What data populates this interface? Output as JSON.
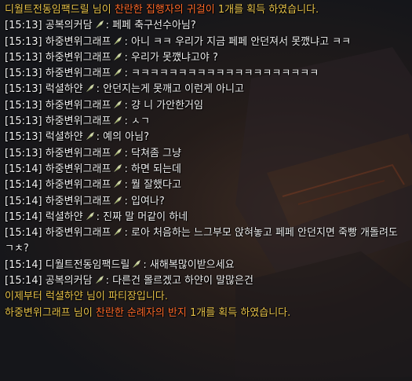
{
  "colors": {
    "system_text": "#e8c34a",
    "item_text": "#ff6a2a",
    "chat_text": "#f2f2f2"
  },
  "icons": {
    "badge": "wing-badge-icon"
  },
  "messages": [
    {
      "type": "system",
      "name": "디월트전동임팩드릴",
      "pre": " 님이 ",
      "item": "찬란한 집행자의 귀걸이",
      "post": " 1개를 획득 하였습니다."
    },
    {
      "type": "chat",
      "time": "[15:13]",
      "name": "공복의커담",
      "text": ": 페페 축구선수아님?"
    },
    {
      "type": "chat",
      "time": "[15:13]",
      "name": "하중변위그래프",
      "text": ": 아니 ㅋㅋ 우리가 지금 페페 안던져서 못깼냐고 ㅋㅋ"
    },
    {
      "type": "chat",
      "time": "[15:13]",
      "name": "하중변위그래프",
      "text": ": 우리가 못깼냐고야 ?"
    },
    {
      "type": "chat",
      "time": "[15:13]",
      "name": "하중변위그래프",
      "text": ": ㅋㅋㅋㅋㅋㅋㅋㅋㅋㅋㅋㅋㅋㅋㅋㅋㅋㅋㅋㅋ"
    },
    {
      "type": "chat",
      "time": "[15:13]",
      "name": "럭셜하얀",
      "text": ": 안던지는게 못깨고 이런게 아니고"
    },
    {
      "type": "chat",
      "time": "[15:13]",
      "name": "하중변위그래프",
      "text": ": 걍 니 가안한거임"
    },
    {
      "type": "chat",
      "time": "[15:13]",
      "name": "하중변위그래프",
      "text": ": ㅅㄱ"
    },
    {
      "type": "chat",
      "time": "[15:13]",
      "name": "럭셜하얀",
      "text": ": 예의 아님?"
    },
    {
      "type": "chat",
      "time": "[15:13]",
      "name": "하중변위그래프",
      "text": ": 닥쳐좀 그냥"
    },
    {
      "type": "chat",
      "time": "[15:14]",
      "name": "하중변위그래프",
      "text": ": 하면 되는데"
    },
    {
      "type": "chat",
      "time": "[15:14]",
      "name": "하중변위그래프",
      "text": ": 뭘 잘했다고"
    },
    {
      "type": "chat",
      "time": "[15:14]",
      "name": "하중변위그래프",
      "text": ": 입여나?"
    },
    {
      "type": "chat",
      "time": "[15:14]",
      "name": "럭셜하얀",
      "text": ": 진짜 말 머같이 하네"
    },
    {
      "type": "chat",
      "time": "[15:14]",
      "name": "하중변위그래프",
      "text": ": 로아 처음하는 느그부모 앉혀놓고 페페 안던지면 죽빵 개돌려도 ㄱㅊ?"
    },
    {
      "type": "chat",
      "time": "[15:14]",
      "name": "디월트전동임팩드릴",
      "text": ": 새해복많이받으세요"
    },
    {
      "type": "chat",
      "time": "[15:14]",
      "name": "공복의커담",
      "text": ": 다른건 몰르겠고 하얀이 말많은건"
    },
    {
      "type": "notice",
      "text": "이제부터 럭셜하얀 님이 파티장입니다."
    },
    {
      "type": "system",
      "name": "하중변위그래프",
      "pre": " 님이 ",
      "item": "찬란한 순례자의 반지",
      "post": " 1개를 획득 하였습니다."
    }
  ]
}
